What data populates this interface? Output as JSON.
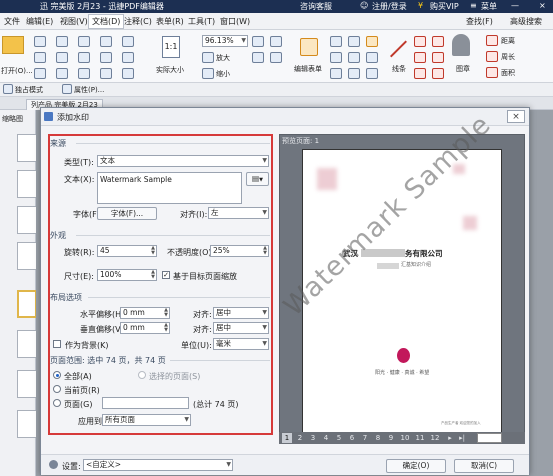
{
  "titlebar": {
    "title": "迅 完美版 2月23 - 迅捷PDF编辑器",
    "consult": "咨询客服",
    "login": "注册/登录",
    "buy": "购买VIP",
    "menu": "菜单"
  },
  "menu": {
    "items": [
      "文件",
      "编辑(E)",
      "视图(V)",
      "文档(D)",
      "注释(C)",
      "表单(R)",
      "工具(T)",
      "窗口(W)"
    ],
    "search": "查找(F)",
    "advanced_search": "高级搜索"
  },
  "ribbon": {
    "open": "打开(O)...",
    "zoom": "96.13%",
    "zoom_in": "放大",
    "zoom_out": "缩小",
    "actual_size": "实际大小",
    "edit_form": "编辑表单",
    "line": "线条",
    "stamp": "图章",
    "distance": "距离",
    "perimeter": "周长",
    "area": "面积"
  },
  "toolbar2": {
    "mode": "独占模式",
    "properties": "属性(P)..."
  },
  "doctab": {
    "tab": "列产品 完美版 2月23"
  },
  "leftpanel": {
    "label": "缩略图"
  },
  "dialog": {
    "title": "添加水印",
    "close": "×",
    "source": {
      "section": "来源",
      "type_label": "类型(T):",
      "type_value": "文本",
      "text_label": "文本(X):",
      "text_value": "Watermark Sample",
      "font_label": "字体(F):",
      "font_button": "字体(F)...",
      "align_label": "对齐(I):",
      "align_value": "左"
    },
    "appearance": {
      "section": "外观",
      "rotation_label": "旋转(R):",
      "rotation_value": "45",
      "opacity_label": "不透明度(O):",
      "opacity_value": "25%",
      "size_label": "尺寸(E):",
      "size_value": "100%",
      "scale_label": "基于目标页面缩放"
    },
    "layout": {
      "section": "布局选项",
      "h_offset_label": "水平偏移(H):",
      "h_offset_value": "0 mm",
      "h_align_label": "对齐:",
      "h_align_value": "居中",
      "v_offset_label": "垂直偏移(V):",
      "v_offset_value": "0 mm",
      "v_align_label": "对齐:",
      "v_align_value": "居中",
      "background_label": "作为背景(K)",
      "unit_label": "单位(U):",
      "unit_value": "毫米"
    },
    "range": {
      "section": "页面范围: 选中 74 页，共 74 页",
      "all": "全部(A)",
      "selected": "选择的页面(S)",
      "current": "当前页(R)",
      "pages": "页面(G)",
      "total": "(总计 74 页)",
      "apply_label": "应用到:",
      "apply_value": "所有页面"
    },
    "preview": {
      "label": "预览页面: 1",
      "company_left": "武汉",
      "company_right": "务有限公司",
      "subtitle": "汇基知识介绍",
      "tagline": "阳光 · 健康 · 真诚 · 希望",
      "footer": "产品生产者 欢迎您的加入",
      "watermark": "Watermark Sample",
      "pages": [
        "1",
        "2",
        "3",
        "4",
        "5",
        "6",
        "7",
        "8",
        "9",
        "10",
        "11",
        "12"
      ]
    },
    "bottom": {
      "settings_label": "设置:",
      "settings_value": "<自定义>",
      "ok": "确定(O)",
      "cancel": "取消(C)"
    }
  }
}
